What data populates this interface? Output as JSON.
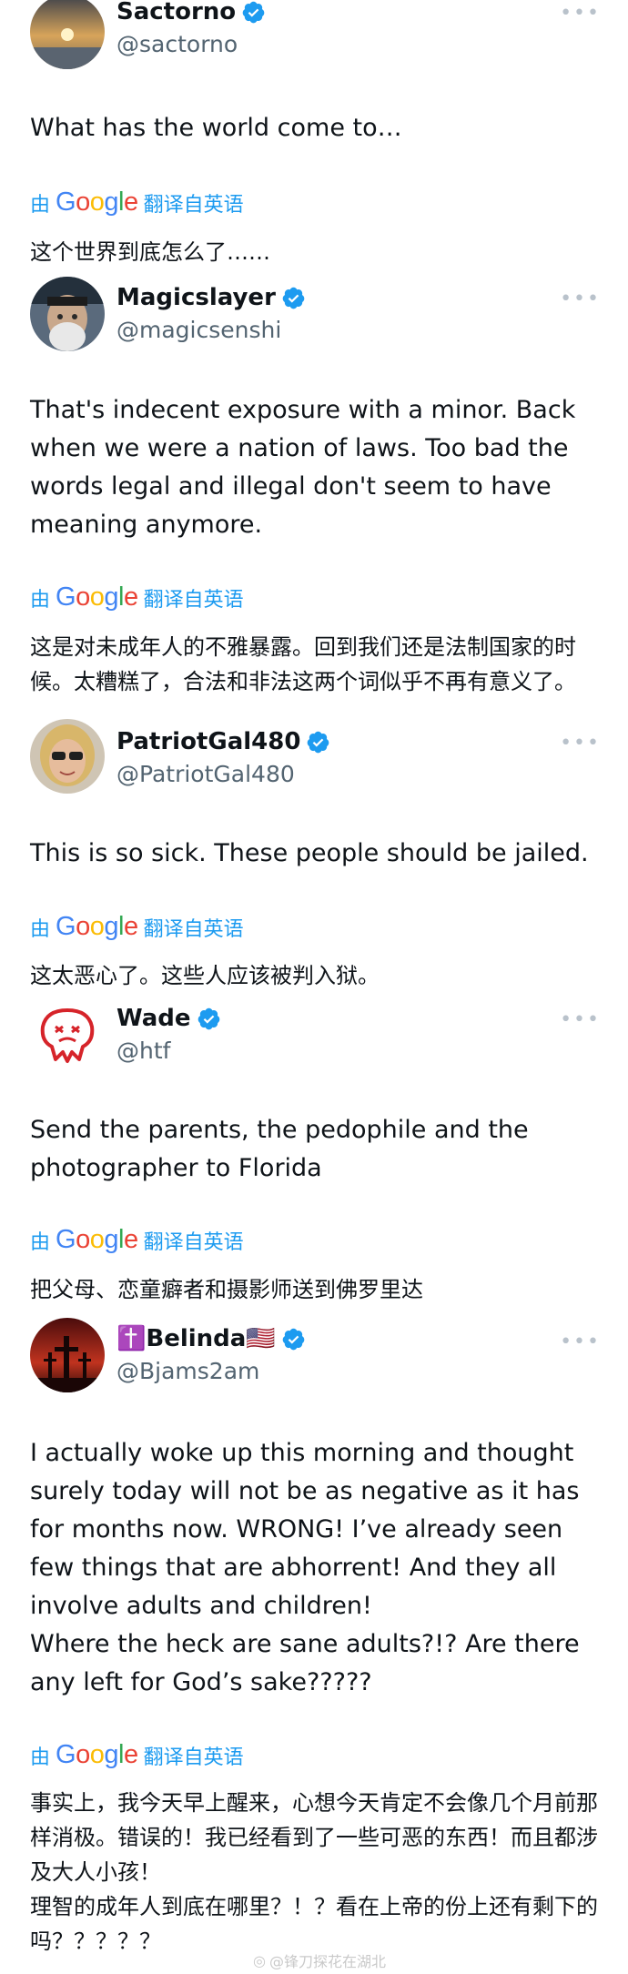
{
  "colors": {
    "verified_blue": "#1d9bf0",
    "translate_blue": "#1d9bf0",
    "handle_gray": "#536471",
    "text": "#0f1419"
  },
  "icons": {
    "verified": "verified-badge-icon",
    "more": "more-options-icon",
    "google": "google-logo"
  },
  "translate": {
    "prefix": "由",
    "brand": "Google",
    "suffix": "翻译自英语"
  },
  "tweets": [
    {
      "display_name": "Sactorno",
      "handle": "@sactorno",
      "text": "What has the world come to…",
      "translation": "这个世界到底怎么了……"
    },
    {
      "display_name": "Magicslayer",
      "handle": "@magicsenshi",
      "text": "That's indecent exposure with a minor. Back when we were a nation of laws. Too bad the words legal and illegal don't seem to have meaning anymore.",
      "translation": "这是对未成年人的不雅暴露。回到我们还是法制国家的时候。太糟糕了，合法和非法这两个词似乎不再有意义了。"
    },
    {
      "display_name": "PatriotGal480",
      "handle": "@PatriotGal480",
      "text": "This is so sick. These people should be jailed.",
      "translation": "这太恶心了。这些人应该被判入狱。"
    },
    {
      "display_name": "Wade",
      "handle": "@htf",
      "text": "Send the parents, the pedophile and the photographer to Florida",
      "translation": "把父母、恋童癖者和摄影师送到佛罗里达"
    },
    {
      "display_name": "✝️Belinda🇺🇸",
      "handle": "@Bjams2am",
      "text": "I actually woke up this morning and thought surely today will not be as negative as it has for months now. WRONG! I’ve already seen few things that are abhorrent! And they all involve adults and children!\nWhere the heck are sane adults?!? Are there any left for God’s sake?????",
      "translation": "事实上，我今天早上醒来，心想今天肯定不会像几个月前那样消极。错误的！我已经看到了一些可恶的东西！而且都涉及大人小孩！\n理智的成年人到底在哪里？！？看在上帝的份上还有剩下的吗？？？？？"
    }
  ],
  "watermark": "@锋刀探花在湖北"
}
